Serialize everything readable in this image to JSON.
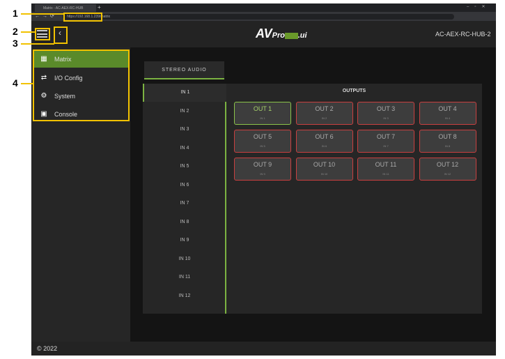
{
  "browser": {
    "tab_title": "Matrix - AC-AEX-RC-HUB",
    "url": "https://192.168.1.239/matrix",
    "new_tab": "+"
  },
  "header": {
    "logo_av": "AV",
    "logo_pro": "Pro",
    "logo_ui": ".ui",
    "device_name": "AC-AEX-RC-HUB-2"
  },
  "sidebar": {
    "items": [
      {
        "label": "Matrix",
        "icon": "grid-icon"
      },
      {
        "label": "I/O Config",
        "icon": "plug-icon"
      },
      {
        "label": "System",
        "icon": "gear-icon"
      },
      {
        "label": "Console",
        "icon": "terminal-icon"
      }
    ]
  },
  "main": {
    "tab": "STEREO AUDIO",
    "outputs_title": "OUTPUTS",
    "inputs": [
      "IN 1",
      "IN 2",
      "IN 3",
      "IN 4",
      "IN 5",
      "IN 6",
      "IN 7",
      "IN 8",
      "IN 9",
      "IN 10",
      "IN 11",
      "IN 12"
    ],
    "outputs": [
      {
        "label": "OUT 1",
        "source": "IN 1"
      },
      {
        "label": "OUT 2",
        "source": "IN 2"
      },
      {
        "label": "OUT 3",
        "source": "IN 3"
      },
      {
        "label": "OUT 4",
        "source": "IN 4"
      },
      {
        "label": "OUT 5",
        "source": "IN 5"
      },
      {
        "label": "OUT 6",
        "source": "IN 6"
      },
      {
        "label": "OUT 7",
        "source": "IN 7"
      },
      {
        "label": "OUT 8",
        "source": "IN 8"
      },
      {
        "label": "OUT 9",
        "source": "IN 9"
      },
      {
        "label": "OUT 10",
        "source": "IN 10"
      },
      {
        "label": "OUT 11",
        "source": "IN 11"
      },
      {
        "label": "OUT 12",
        "source": "IN 12"
      }
    ]
  },
  "footer": {
    "copyright": "© 2022"
  },
  "annotations": [
    "1",
    "2",
    "3",
    "4"
  ],
  "colors": {
    "accent": "#7cb342",
    "unselected": "#c94040",
    "highlight": "#f2c200"
  }
}
